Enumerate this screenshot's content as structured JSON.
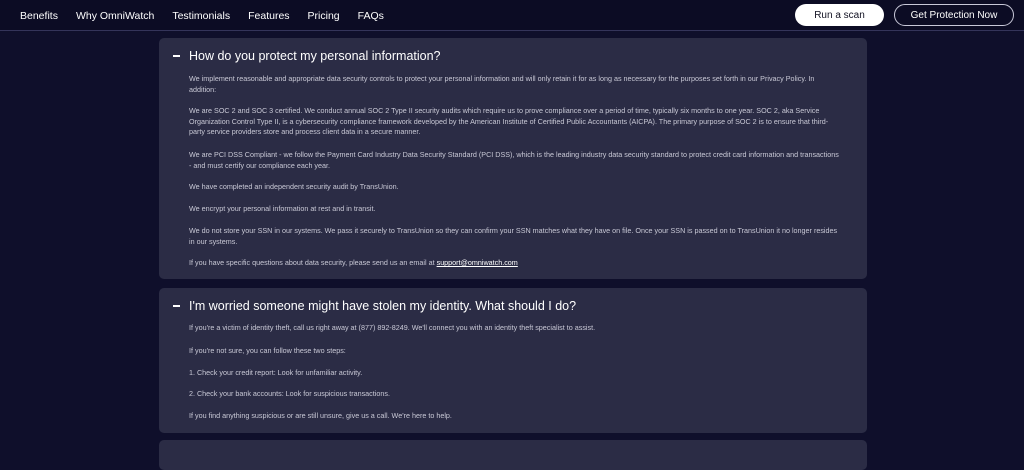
{
  "nav": {
    "links": [
      "Benefits",
      "Why OmniWatch",
      "Testimonials",
      "Features",
      "Pricing",
      "FAQs"
    ],
    "scan_button": "Run a scan",
    "protect_button": "Get Protection Now"
  },
  "faq1": {
    "question": "How do you protect my personal information?",
    "paragraphs": [
      "We implement reasonable and appropriate data security controls to protect your personal information and will only retain it for as long as necessary for the purposes set forth in our Privacy Policy. In addition:",
      "We are SOC 2 and SOC 3 certified. We conduct annual SOC 2 Type II security audits which require us to prove compliance over a period of time, typically six months to one year. SOC 2, aka Service Organization Control Type II, is a cybersecurity compliance framework developed by the American Institute of Certified Public Accountants (AICPA). The primary purpose of SOC 2 is to ensure that third-party service providers store and process client data in a secure manner.",
      "We are PCI DSS Compliant - we follow the Payment Card Industry Data Security Standard (PCI DSS), which is the leading industry data security standard to protect credit card information and transactions - and must certify our compliance each year.",
      "We have completed an independent security audit by TransUnion.",
      "We encrypt your personal information at rest and in transit.",
      "We do not store your SSN in our systems. We pass it securely to TransUnion so they can confirm your SSN matches what they have on file. Once your SSN is passed on to TransUnion it no longer resides in our systems."
    ],
    "last_paragraph_prefix": "If you have specific questions about data security, please send us an email at ",
    "email": "support@omniwatch.com"
  },
  "faq2": {
    "question": "I'm worried someone might have stolen my identity. What should I do?",
    "paragraphs": [
      "If you're a victim of identity theft, call us right away at (877) 892-8249. We'll connect you with an identity theft specialist to assist.",
      "If you're not sure, you can follow these two steps:",
      "1. Check your credit report: Look for unfamiliar activity.",
      "2. Check your bank accounts: Look for suspicious transactions.",
      "If you find anything suspicious or are still unsure, give us a call. We're here to help."
    ]
  }
}
